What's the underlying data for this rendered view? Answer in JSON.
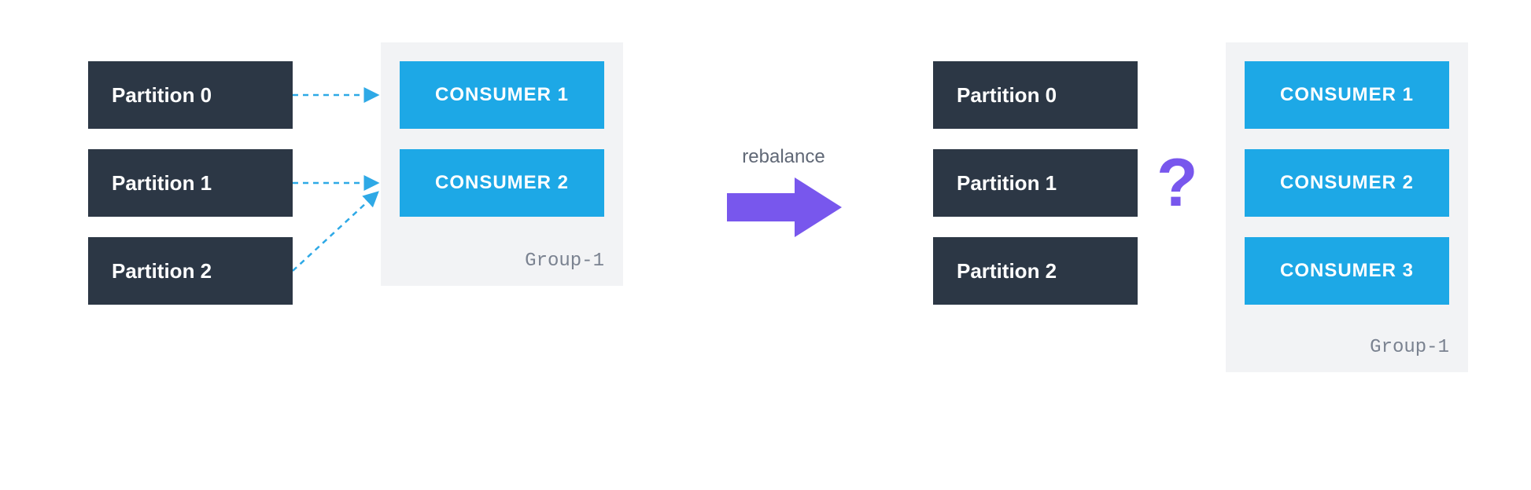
{
  "left": {
    "partitions": [
      {
        "label": "Partition 0"
      },
      {
        "label": "Partition 1"
      },
      {
        "label": "Partition 2"
      }
    ],
    "group": {
      "label": "Group-1",
      "consumers": [
        {
          "label": "CONSUMER 1"
        },
        {
          "label": "CONSUMER 2"
        }
      ]
    }
  },
  "center": {
    "label": "rebalance"
  },
  "right": {
    "partitions": [
      {
        "label": "Partition 0"
      },
      {
        "label": "Partition 1"
      },
      {
        "label": "Partition 2"
      }
    ],
    "group": {
      "label": "Group-1",
      "consumers": [
        {
          "label": "CONSUMER 1"
        },
        {
          "label": "CONSUMER 2"
        },
        {
          "label": "CONSUMER 3"
        }
      ]
    },
    "question": "?"
  },
  "colors": {
    "partition_bg": "#2c3745",
    "consumer_bg": "#1da8e6",
    "group_bg": "#f2f3f5",
    "arrow": "#7857ed",
    "dashed": "#2ea9e6"
  }
}
